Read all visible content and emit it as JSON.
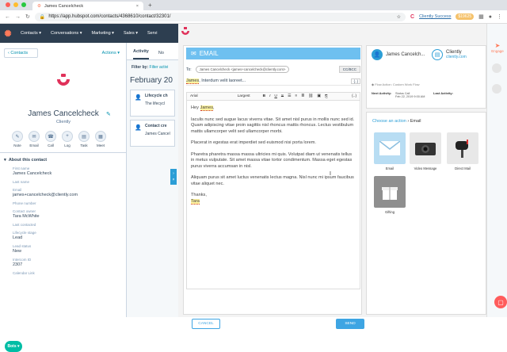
{
  "browser": {
    "tab_title": "James Cancelcheck",
    "url": "https://app.hubspot.com/contacts/4368610/contact/32301/",
    "profile_label": "Cliently Success",
    "badge": "$19625"
  },
  "hubspot_nav": [
    "Contacts",
    "Conversations",
    "Marketing",
    "Sales",
    "Servi"
  ],
  "contact": {
    "back_label": "Contacts",
    "actions_label": "Actions",
    "name": "James Cancelcheck",
    "company": "Cliently",
    "quick_actions": [
      "Note",
      "Email",
      "Call",
      "Log",
      "Task",
      "Meet"
    ],
    "about_heading": "About this contact",
    "properties": [
      {
        "label": "First name",
        "value": "James Cancelcheck"
      },
      {
        "label": "Last name",
        "value": ""
      },
      {
        "label": "Email",
        "value": "james+cancelcheck@cliently.com"
      },
      {
        "label": "Phone number",
        "value": ""
      },
      {
        "label": "Contact owner",
        "value": "Tara McWhite"
      },
      {
        "label": "Last contacted",
        "value": ""
      },
      {
        "label": "Lifecycle stage",
        "value": "Lead"
      },
      {
        "label": "Lead status",
        "value": "New"
      },
      {
        "label": "Intercom ID",
        "value": "2307"
      },
      {
        "label": "Calendar Link",
        "value": ""
      }
    ],
    "bots_label": "Bots"
  },
  "activity": {
    "tabs": [
      "Activity",
      "No"
    ],
    "filter_label": "Filter by:",
    "filter_link": "Filter activi",
    "month": "February 20",
    "cards": [
      {
        "title": "Lifecycle ch",
        "text": "The lifecycl"
      },
      {
        "title": "Contact cre",
        "text": "James Cancel"
      }
    ]
  },
  "compose": {
    "header": "EMAIL",
    "to_label": "To:",
    "to_chip": "James Cancelcheck <james+cancelcheck@cliently.com>",
    "ccbcc": "CC/BCC",
    "subject_name": "James",
    "subject_rest": ", Interdum velit laoreet...",
    "toolbar": {
      "font": "Arial",
      "size": "Largest",
      "bold": "B",
      "italic": "I",
      "underline": "U",
      "strike": "S"
    },
    "greeting_pre": "Hey ",
    "greeting_name": "James",
    "paragraphs": [
      "Iaculis nunc sed augue lacus viverra vitae. Sit amet nisl purus in mollis nunc sed id. Quam adipiscing vitae proin sagittis nisl rhoncus mattis rhoncus. Lectus vestibulum mattis ullamcorper velit sed ullamcorper morbi.",
      "Placerat in egestas erat imperdiet sed euismod nisi porta lorem.",
      "Pharetra pharetra massa massa ultricies mi quis. Volutpat diam ut venenatis tellus in metus vulputate. Sit amet massa vitae tortor condimentum. Massa eget egestas purus viverra accumsan in nisl.",
      "Aliquam purus sit amet luctus venenatis lectus magna. Nisl nunc mi ipsum faucibus vitae aliquet nec."
    ],
    "signoff": "Thanks,",
    "signature": "Tara",
    "cancel": "CANCEL",
    "send": "SEND"
  },
  "side_card": {
    "person_name": "James Cancelch...",
    "company": "Cliently",
    "company_link": "cliently.com",
    "flow_label": "Flow Action: Custom Work Flow",
    "next_activity_label": "Next Activity:",
    "next_activity": "Status Call",
    "next_activity_date": "Feb 22, 2019 9:00 AM",
    "last_activity_label": "Last Activity:"
  },
  "choose_action": {
    "prefix": "Choose an action",
    "current": "Email",
    "tiles": [
      "Email",
      "Video Message",
      "Direct Mail",
      "Gifting"
    ]
  },
  "rail": {
    "engage": "Engage"
  },
  "colors": {
    "hubspot_nav": "#2d3e50",
    "cliently_blue": "#3ea5e3",
    "cliently_red": "#e0315a",
    "hubspot_orange": "#ff7a59"
  }
}
